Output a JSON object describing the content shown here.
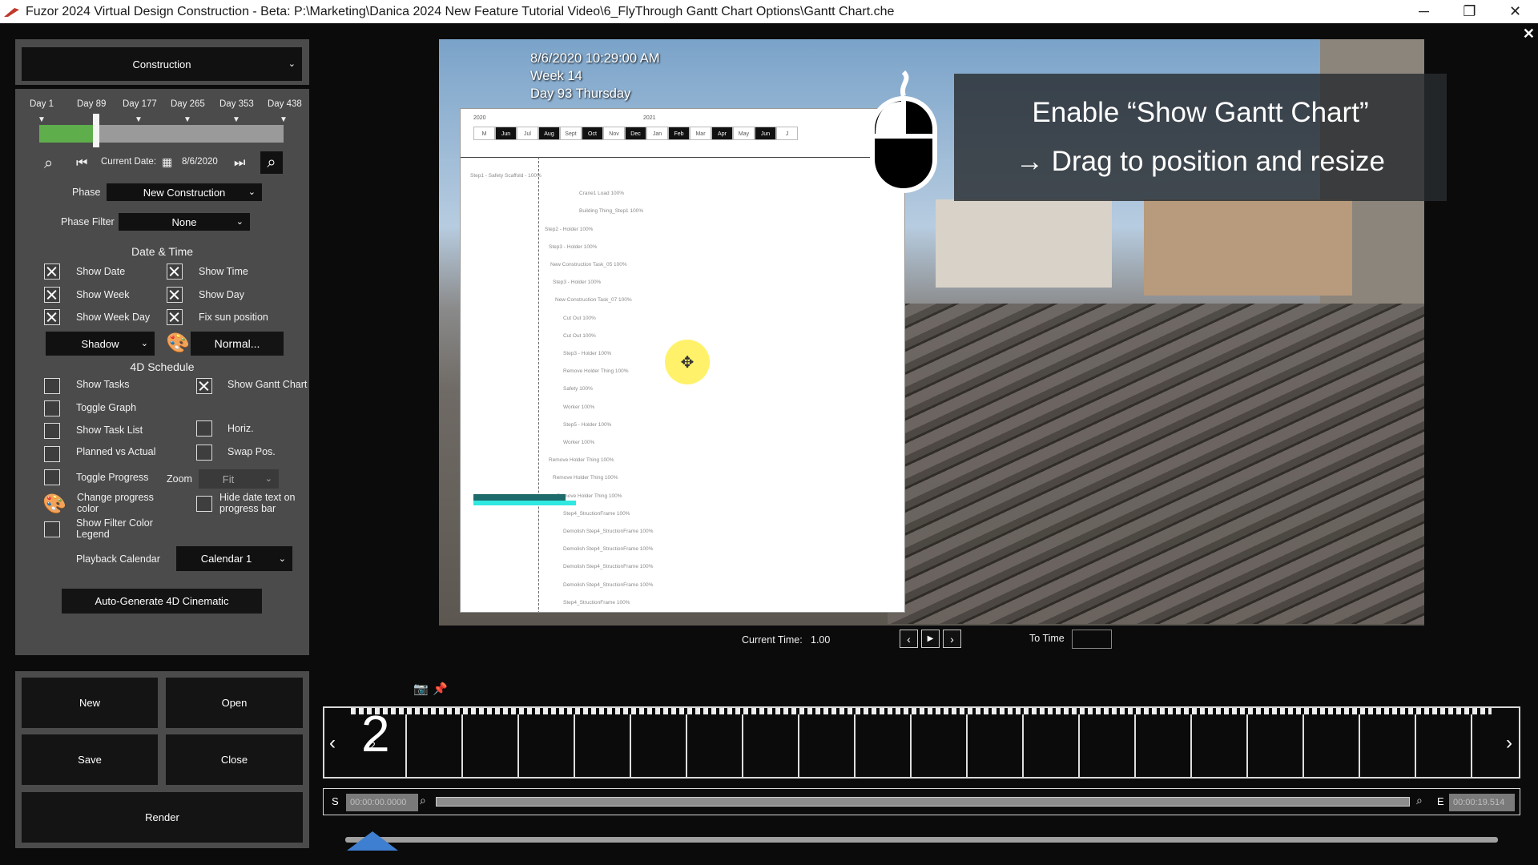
{
  "window": {
    "title": "Fuzor 2024 Virtual Design Construction - Beta: P:\\Marketing\\Danica 2024 New Feature Tutorial Video\\6_FlyThrough Gantt Chart Options\\Gantt Chart.che",
    "minimize": "─",
    "restore": "❐",
    "close": "✕",
    "overlay_close": "✕"
  },
  "panel": {
    "mode_select": "Construction",
    "timeline_days": [
      "Day 1",
      "Day 89",
      "Day 177",
      "Day 265",
      "Day 353",
      "Day 438"
    ],
    "timeline_progress": 0.22,
    "current_date_label": "Current Date:",
    "current_date_value": "8/6/2020",
    "phase_label": "Phase",
    "phase_value": "New Construction",
    "phase_filter_label": "Phase Filter",
    "phase_filter_value": "None",
    "date_time_header": "Date & Time",
    "show_date": "Show Date",
    "show_time": "Show Time",
    "show_week": "Show Week",
    "show_day": "Show Day",
    "show_week_day": "Show Week Day",
    "fix_sun": "Fix sun position",
    "shadow_select": "Shadow",
    "normal_button": "Normal...",
    "schedule_header": "4D Schedule",
    "show_tasks": "Show Tasks",
    "show_gantt": "Show Gantt Chart",
    "toggle_graph": "Toggle Graph",
    "show_task_list": "Show Task List",
    "horiz": "Horiz.",
    "planned_vs_actual": "Planned vs Actual",
    "swap_pos": "Swap Pos.",
    "toggle_progress": "Toggle Progress",
    "zoom_label": "Zoom",
    "zoom_value": "Fit",
    "change_progress_color_1": "Change progress",
    "change_progress_color_2": "color",
    "hide_date_text_1": "Hide date text on",
    "hide_date_text_2": "progress bar",
    "show_filter_color_1": "Show Filter Color",
    "show_filter_color_2": "Legend",
    "playback_calendar_label": "Playback Calendar",
    "playback_calendar_value": "Calendar 1",
    "auto_generate": "Auto-Generate 4D Cinematic"
  },
  "file_buttons": {
    "new": "New",
    "open": "Open",
    "save": "Save",
    "close": "Close",
    "render": "Render"
  },
  "viewport": {
    "datetime": "8/6/2020 10:29:00 AM",
    "week": "Week 14",
    "day": "Day 93 Thursday",
    "callout_line1": "Enable “Show Gantt Chart”",
    "callout_line2": "→ Drag to position and resize",
    "gantt": {
      "year_left": "2020",
      "year_right": "2021",
      "months": [
        "M",
        "Jun",
        "Jul",
        "Aug",
        "Sept",
        "Oct",
        "Nov",
        "Dec",
        "Jan",
        "Feb",
        "Mar",
        "Apr",
        "May",
        "Jun",
        "J"
      ],
      "rows": [
        "Step1 - Safety Scaffold - 100%",
        "Crane1 Load 100%",
        "Building Thing_Step1 100%",
        "Step2 - Holder 100%",
        "Step3 - Holder 100%",
        "New Construction Task_05 100%",
        "Step3 - Holder 100%",
        "New Construction Task_07 100%",
        "Cut Out 100%",
        "Cut Out 100%",
        "Step3 - Holder 100%",
        "Remove Holder Thing 100%",
        "Safety 100%",
        "Worker 100%",
        "Step5 - Holder 100%",
        "Worker 100%",
        "Remove Holder Thing 100%",
        "Remove Holder Thing 100%",
        "Remove Holder Thing 100%",
        "Step4_StructionFrame 100%",
        "Demolish Step4_StructionFrame 100%",
        "Demolish Step4_StructionFrame 100%",
        "Demolish Step4_StructionFrame 100%",
        "Demolish Step4_StructionFrame 100%",
        "Step4_StructionFrame 100%"
      ]
    }
  },
  "playback": {
    "current_time_label": "Current Time:",
    "current_time_value": "1.00",
    "to_time_label": "To Time",
    "prev": "‹",
    "play": "▶",
    "next": "›"
  },
  "filmstrip": {
    "frame_big": "2",
    "frame_small": "2",
    "left_arrow": "‹",
    "right_arrow": "›",
    "start_label": "S",
    "start_time": "00:00:00.0000",
    "end_label": "E",
    "end_time": "00:00:19.514"
  }
}
